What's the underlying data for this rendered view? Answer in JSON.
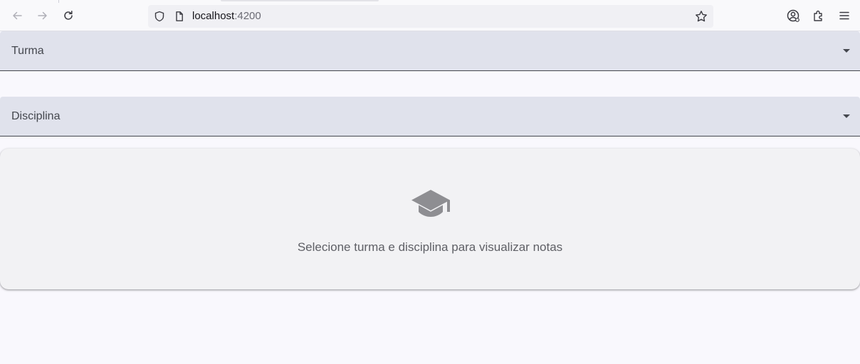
{
  "browser": {
    "url_host": "localhost",
    "url_port": ":4200",
    "icons": {
      "back": "arrow-left-icon",
      "forward": "arrow-right-icon",
      "reload": "reload-icon",
      "site_info": "shield-icon",
      "page": "page-icon",
      "bookmark": "star-icon",
      "account": "account-icon",
      "extensions": "puzzle-icon",
      "menu": "hamburger-menu-icon"
    }
  },
  "filters": {
    "turma": {
      "label": "Turma"
    },
    "disciplina": {
      "label": "Disciplina"
    }
  },
  "empty_state": {
    "icon": "graduation-cap-icon",
    "message": "Selecione turma e disciplina para visualizar notas"
  },
  "colors": {
    "page_background": "#f9f8fd",
    "select_background": "#e0e2ec",
    "card_background": "#f2f2f4",
    "icon_gray": "#8e8e92"
  }
}
